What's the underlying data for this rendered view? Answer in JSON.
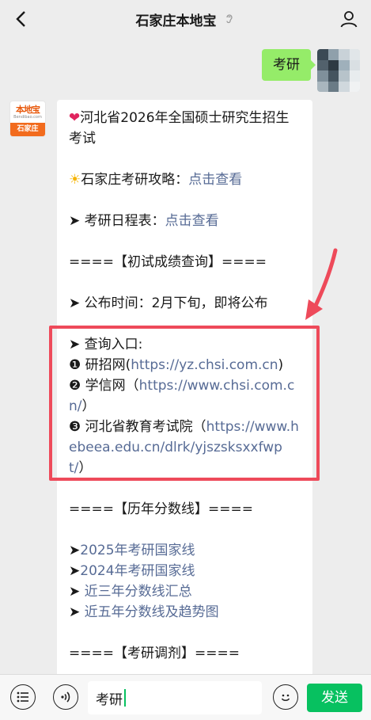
{
  "header": {
    "title": "石家庄本地宝"
  },
  "outgoing": {
    "text": "考研"
  },
  "bot": {
    "avatar_logo": "本地宝",
    "avatar_sub": "Bendibao.com",
    "avatar_city": "石家庄"
  },
  "message": {
    "heart": "❤",
    "title": "河北省2026年全国硕士研究生招生考试",
    "sun": "☀",
    "guide_label": "石家庄考研攻略：",
    "guide_link": "点击查看",
    "schedule_label": "➤ 考研日程表：",
    "schedule_link": "点击查看",
    "section1": "====【初试成绩查询】====",
    "publish_time": "➤ 公布时间：2月下旬，即将公布",
    "entry_label": "➤ 查询入口:",
    "entry1_prefix": "❶ 研招网(",
    "entry1_link": "https://yz.chsi.com.cn",
    "entry1_suffix": ")",
    "entry2_prefix": "❷ 学信网（",
    "entry2_link": "https://www.chsi.com.cn/",
    "entry2_suffix": "）",
    "entry3_prefix": "❸ 河北省教育考试院（",
    "entry3_link": "https://www.hebeea.edu.cn/dlrk/yjszsksxxfwpt/",
    "entry3_suffix": "）",
    "section2": "====【历年分数线】====",
    "score_prefix": "➤",
    "score1": "2025年考研国家线",
    "score2": "2024年考研国家线",
    "score3": "近三年分数线汇总",
    "score4": "近五年分数线及趋势图",
    "section3": "====【考研调剂】===="
  },
  "input": {
    "value": "考研",
    "send_label": "发送"
  },
  "colors": {
    "bubble_out": "#95ec69",
    "link": "#576b95",
    "send": "#07c160",
    "highlight": "#ee4a5a"
  }
}
